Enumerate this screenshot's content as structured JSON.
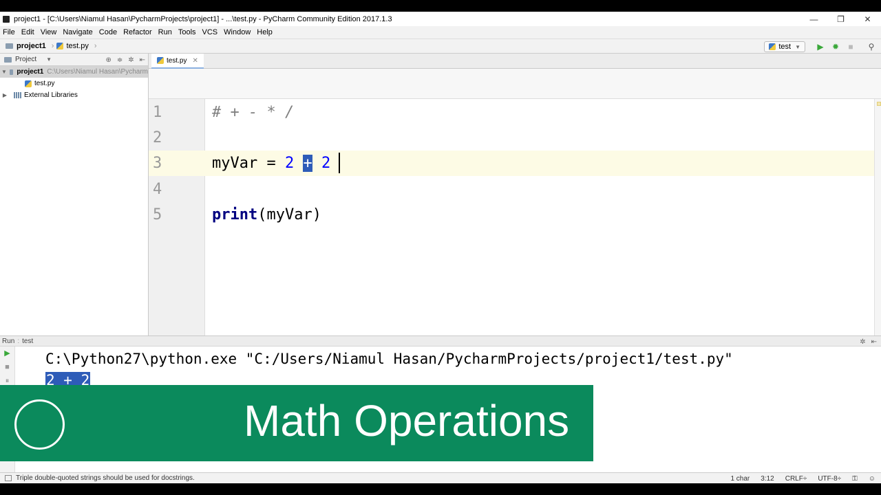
{
  "window": {
    "title": "project1 - [C:\\Users\\Niamul Hasan\\PycharmProjects\\project1] - ...\\test.py - PyCharm Community Edition 2017.1.3",
    "controls": [
      "—",
      "❐",
      "✕"
    ]
  },
  "menu": [
    "File",
    "Edit",
    "View",
    "Navigate",
    "Code",
    "Refactor",
    "Run",
    "Tools",
    "VCS",
    "Window",
    "Help"
  ],
  "navbar": {
    "crumbs": [
      "project1",
      "test.py"
    ],
    "run_config": "test"
  },
  "project_panel": {
    "header": "Project",
    "root_label": "project1",
    "root_path": "C:\\Users\\Niamul Hasan\\Pycharm",
    "file": "test.py",
    "libraries": "External Libraries"
  },
  "editor": {
    "tab": "test.py",
    "line_numbers": [
      "1",
      "2",
      "3",
      "4",
      "5"
    ],
    "line1": "# + - * /",
    "line3_var": "myVar = ",
    "line3_a": "2",
    "line3_op": "+",
    "line3_b": "2",
    "line5_kw": "print",
    "line5_rest": "(myVar)"
  },
  "run_panel": {
    "label": "Run",
    "config": "test",
    "command": "C:\\Python27\\python.exe \"C:/Users/Niamul Hasan/PycharmProjects/project1/test.py\"",
    "output": "2 + 2"
  },
  "banner": {
    "text": "Math Operations",
    "color": "#0b8a5c"
  },
  "statusbar": {
    "message": "Triple double-quoted strings should be used for docstrings.",
    "selection": "1 char",
    "position": "3:12",
    "line_sep": "CRLF÷",
    "encoding": "UTF-8÷"
  }
}
